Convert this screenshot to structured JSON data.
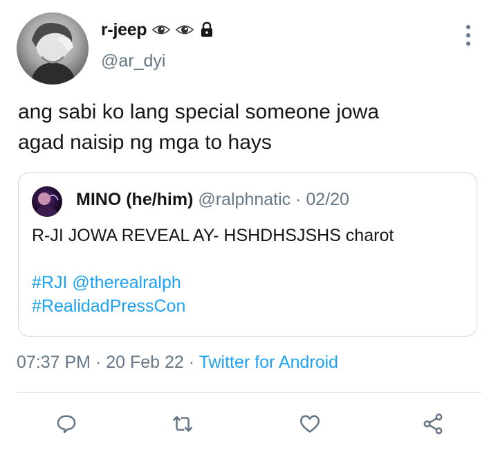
{
  "author": {
    "display_name": "r-jeep",
    "handle": "@ar_dyi",
    "badges": [
      "eye-emoji",
      "eye-emoji",
      "lock-icon"
    ]
  },
  "tweet": {
    "text_line1": "ang sabi ko lang special someone jowa",
    "text_line2": "agad naisip ng mga to hays"
  },
  "quoted": {
    "name": "MINO (he/him)",
    "handle": "@ralphnatic",
    "separator": " · ",
    "date": "02/20",
    "text": "R-JI JOWA REVEAL AY- HSHDHSJSHS charot",
    "tags_line1": "#RJI @therealralph",
    "tags_line2": "#RealidadPressCon"
  },
  "meta": {
    "time": "07:37 PM",
    "sep1": " · ",
    "date": "20 Feb 22",
    "sep2": " · ",
    "source": "Twitter for Android"
  },
  "actions": [
    "reply-icon",
    "retweet-icon",
    "like-icon",
    "share-icon"
  ],
  "colors": {
    "link": "#1da1f2",
    "secondary": "#657786",
    "text": "#14171a",
    "border": "#cfd9de"
  }
}
